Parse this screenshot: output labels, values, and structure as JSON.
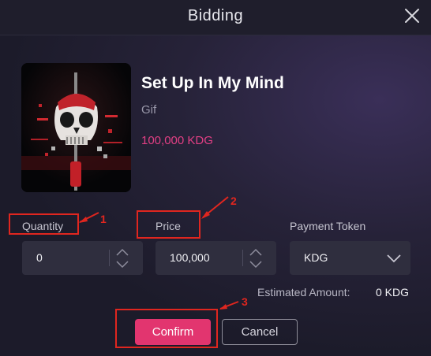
{
  "modal": {
    "title": "Bidding",
    "close_icon": "close-icon"
  },
  "item": {
    "title": "Set Up In My Mind",
    "type": "Gif",
    "price": "100,000 KDG"
  },
  "form": {
    "quantity": {
      "label": "Quantity",
      "value": "0"
    },
    "price": {
      "label": "Price",
      "value": "100,000"
    },
    "payment_token": {
      "label": "Payment Token",
      "value": "KDG"
    },
    "estimated_amount_label": "Estimated Amount:",
    "estimated_amount_value": "0 KDG"
  },
  "actions": {
    "confirm_label": "Confirm",
    "cancel_label": "Cancel"
  },
  "annotations": [
    "1",
    "2",
    "3"
  ],
  "colors": {
    "accent": "#e2356f",
    "price_text": "#e23f84",
    "annotation": "#e0261f"
  }
}
